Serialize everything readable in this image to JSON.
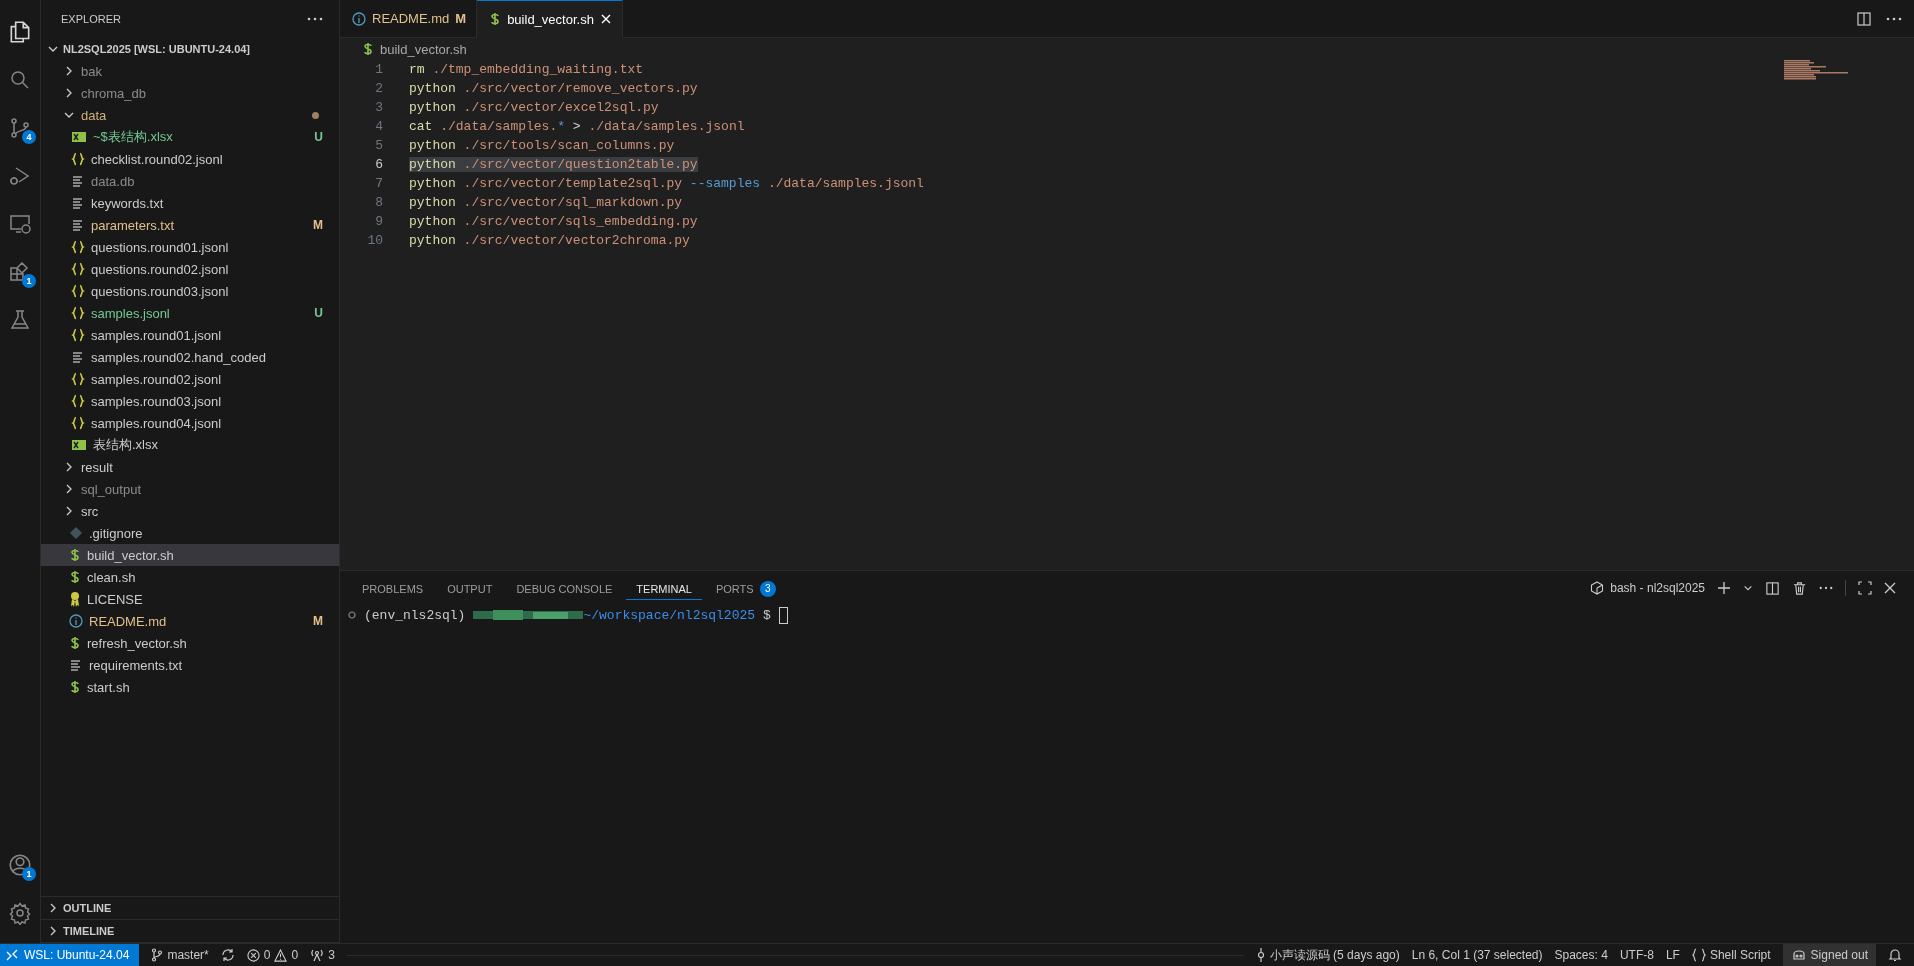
{
  "activity_bar": {
    "top": [
      {
        "kind": "explorer",
        "selected": true
      },
      {
        "kind": "search",
        "selected": false
      },
      {
        "kind": "source-control",
        "selected": false,
        "badge": "4"
      },
      {
        "kind": "run-debug",
        "selected": false
      },
      {
        "kind": "remote",
        "selected": false
      },
      {
        "kind": "extensions",
        "selected": false,
        "badge": "1"
      },
      {
        "kind": "testing",
        "selected": false
      }
    ],
    "bottom": [
      {
        "kind": "account",
        "selected": false,
        "badge": "1"
      },
      {
        "kind": "settings",
        "selected": false
      }
    ]
  },
  "sidebar": {
    "title": "EXPLORER",
    "root": "NL2SQL2025 [WSL: UBUNTU-24.04]",
    "items": [
      {
        "kind": "folder",
        "name": "bak",
        "color": "#8c8c8c",
        "expanded": false,
        "selected": false
      },
      {
        "kind": "folder",
        "name": "chroma_db",
        "color": "#8c8c8c",
        "expanded": false,
        "selected": false
      },
      {
        "kind": "folder",
        "name": "data",
        "color": "#d2b07a",
        "changes_dot": true,
        "expanded": true,
        "selected": false,
        "children": [
          {
            "kind": "excel",
            "name": "~$表结构.xlsx",
            "color": "#73c991",
            "badge": "U",
            "selected": false
          },
          {
            "kind": "json",
            "name": "checklist.round02.jsonl",
            "color": "#cccccc",
            "selected": false
          },
          {
            "kind": "text",
            "name": "data.db",
            "color": "#8c8c8c",
            "selected": false
          },
          {
            "kind": "text",
            "name": "keywords.txt",
            "color": "#cccccc",
            "selected": false
          },
          {
            "kind": "text",
            "name": "parameters.txt",
            "color": "#e2c08d",
            "badge": "M",
            "selected": false
          },
          {
            "kind": "json",
            "name": "questions.round01.jsonl",
            "color": "#cccccc",
            "selected": false
          },
          {
            "kind": "json",
            "name": "questions.round02.jsonl",
            "color": "#cccccc",
            "selected": false
          },
          {
            "kind": "json",
            "name": "questions.round03.jsonl",
            "color": "#cccccc",
            "selected": false
          },
          {
            "kind": "json",
            "name": "samples.jsonl",
            "color": "#73c991",
            "badge": "U",
            "selected": false
          },
          {
            "kind": "json",
            "name": "samples.round01.jsonl",
            "color": "#cccccc",
            "selected": false
          },
          {
            "kind": "text",
            "name": "samples.round02.hand_coded",
            "color": "#cccccc",
            "selected": false
          },
          {
            "kind": "json",
            "name": "samples.round02.jsonl",
            "color": "#cccccc",
            "selected": false
          },
          {
            "kind": "json",
            "name": "samples.round03.jsonl",
            "color": "#cccccc",
            "selected": false
          },
          {
            "kind": "json",
            "name": "samples.round04.jsonl",
            "color": "#cccccc",
            "selected": false
          },
          {
            "kind": "excel",
            "name": "表结构.xlsx",
            "color": "#cccccc",
            "selected": false
          }
        ]
      },
      {
        "kind": "folder",
        "name": "result",
        "color": "#cccccc",
        "expanded": false,
        "selected": false
      },
      {
        "kind": "folder",
        "name": "sql_output",
        "color": "#8c8c8c",
        "expanded": false,
        "selected": false
      },
      {
        "kind": "folder",
        "name": "src",
        "color": "#cccccc",
        "expanded": false,
        "selected": false
      },
      {
        "kind": "git",
        "name": ".gitignore",
        "color": "#cccccc",
        "selected": false
      },
      {
        "kind": "shell",
        "name": "build_vector.sh",
        "color": "#cccccc",
        "selected": true
      },
      {
        "kind": "shell",
        "name": "clean.sh",
        "color": "#cccccc",
        "selected": false
      },
      {
        "kind": "license",
        "name": "LICENSE",
        "color": "#cccccc",
        "selected": false
      },
      {
        "kind": "info",
        "name": "README.md",
        "color": "#e2c08d",
        "badge": "M",
        "selected": false
      },
      {
        "kind": "shell",
        "name": "refresh_vector.sh",
        "color": "#cccccc",
        "selected": false
      },
      {
        "kind": "text",
        "name": "requirements.txt",
        "color": "#cccccc",
        "selected": false
      },
      {
        "kind": "shell",
        "name": "start.sh",
        "color": "#cccccc",
        "selected": false
      }
    ],
    "sections": [
      {
        "title": "OUTLINE",
        "expanded": false
      },
      {
        "title": "TIMELINE",
        "expanded": false
      }
    ]
  },
  "editor": {
    "tabs": [
      {
        "kind": "info",
        "label": "README.md",
        "badge": "M",
        "selected": false
      },
      {
        "kind": "shell",
        "label": "build_vector.sh",
        "selected": true
      }
    ],
    "breadcrumb": "build_vector.sh",
    "lines": [
      {
        "number": "1",
        "selected": false,
        "tokens": [
          {
            "kind": "command",
            "text": "rm"
          },
          {
            "kind": "string",
            "text": " ./tmp_embedding_waiting.txt"
          }
        ]
      },
      {
        "number": "2",
        "selected": false,
        "tokens": [
          {
            "kind": "command",
            "text": "python"
          },
          {
            "kind": "string",
            "text": " ./src/vector/remove_vectors.py"
          }
        ]
      },
      {
        "number": "3",
        "selected": false,
        "tokens": [
          {
            "kind": "command",
            "text": "python"
          },
          {
            "kind": "string",
            "text": " ./src/vector/excel2sql.py"
          }
        ]
      },
      {
        "number": "4",
        "selected": false,
        "tokens": [
          {
            "kind": "command",
            "text": "cat"
          },
          {
            "kind": "string",
            "text": " ./data/samples."
          },
          {
            "kind": "option",
            "text": "*"
          },
          {
            "kind": "plain",
            "text": " > "
          },
          {
            "kind": "string",
            "text": "./data/samples.jsonl"
          }
        ]
      },
      {
        "number": "5",
        "selected": false,
        "tokens": [
          {
            "kind": "command",
            "text": "python"
          },
          {
            "kind": "string",
            "text": " ./src/tools/scan_columns.py"
          }
        ]
      },
      {
        "number": "6",
        "selected": true,
        "tokens": [
          {
            "kind": "command",
            "text": "python"
          },
          {
            "kind": "string",
            "text": " ./src/vector/question2table.py"
          }
        ]
      },
      {
        "number": "7",
        "selected": false,
        "tokens": [
          {
            "kind": "command",
            "text": "python"
          },
          {
            "kind": "string",
            "text": " ./src/vector/template2sql.py "
          },
          {
            "kind": "option",
            "text": "--samples"
          },
          {
            "kind": "string",
            "text": " ./data/samples.jsonl"
          }
        ]
      },
      {
        "number": "8",
        "selected": false,
        "tokens": [
          {
            "kind": "command",
            "text": "python"
          },
          {
            "kind": "string",
            "text": " ./src/vector/sql_markdown.py"
          }
        ]
      },
      {
        "number": "9",
        "selected": false,
        "tokens": [
          {
            "kind": "command",
            "text": "python"
          },
          {
            "kind": "string",
            "text": " ./src/vector/sqls_embedding.py"
          }
        ]
      },
      {
        "number": "10",
        "selected": false,
        "tokens": [
          {
            "kind": "command",
            "text": "python"
          },
          {
            "kind": "string",
            "text": " ./src/vector/vector2chroma.py"
          }
        ]
      }
    ]
  },
  "panel": {
    "tabs": [
      {
        "label": "PROBLEMS",
        "selected": false
      },
      {
        "label": "OUTPUT",
        "selected": false
      },
      {
        "label": "DEBUG CONSOLE",
        "selected": false
      },
      {
        "label": "TERMINAL",
        "selected": true
      },
      {
        "label": "PORTS",
        "selected": false,
        "badge": "3"
      }
    ],
    "terminal_name": "bash - nl2sql2025",
    "prompt": {
      "env": "(env_nls2sql)",
      "path": "~/workspace/nl2sql2025",
      "symbol": "$"
    }
  },
  "status_bar": {
    "remote": "WSL: Ubuntu-24.04",
    "branch": "master*",
    "errors": "0",
    "warnings": "0",
    "ports": "3",
    "right": [
      {
        "kind": "blame",
        "text": "小声读源码 (5 days ago)"
      },
      {
        "kind": "text",
        "text": "Ln 6, Col 1 (37 selected)"
      },
      {
        "kind": "text",
        "text": "Spaces: 4"
      },
      {
        "kind": "text",
        "text": "UTF-8"
      },
      {
        "kind": "text",
        "text": "LF"
      },
      {
        "kind": "language",
        "text": "Shell Script"
      },
      {
        "kind": "account",
        "text": "Signed out"
      }
    ]
  }
}
